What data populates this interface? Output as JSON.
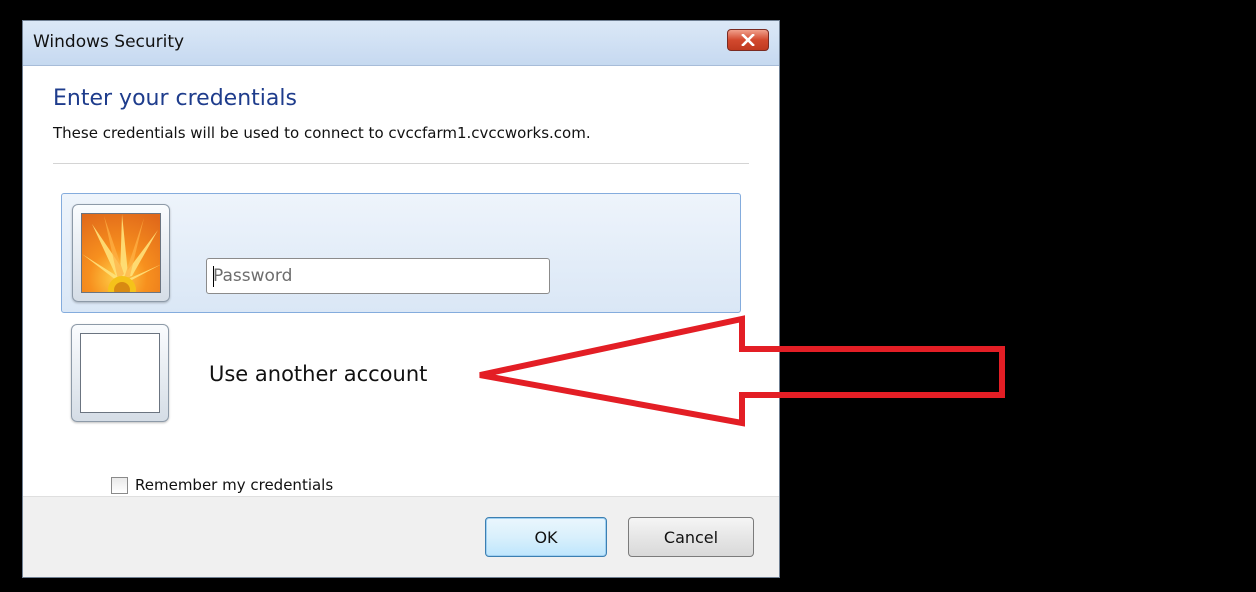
{
  "window": {
    "title": "Windows Security"
  },
  "dialog": {
    "heading": "Enter your credentials",
    "subtext": "These credentials will be used to connect to cvccfarm1.cvccworks.com."
  },
  "credential_tile": {
    "password_placeholder": "Password",
    "password_value": ""
  },
  "other_account_tile": {
    "label": "Use another account"
  },
  "remember": {
    "label": "Remember my credentials",
    "checked": false
  },
  "buttons": {
    "ok_label": "OK",
    "cancel_label": "Cancel"
  },
  "annotation": {
    "arrow_color": "#e31e25"
  },
  "colors": {
    "heading": "#1e3c8c",
    "close_button": "#c84a2e",
    "selected_tile_border": "#84acdd"
  }
}
